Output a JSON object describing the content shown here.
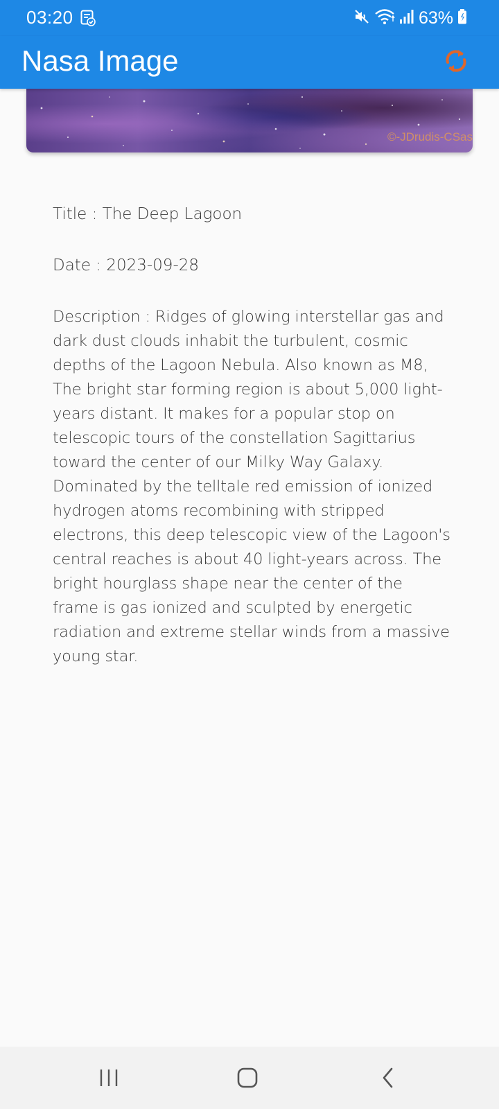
{
  "status_bar": {
    "time": "03:20",
    "battery": "63%",
    "icons": [
      "note-check-icon",
      "mute-icon",
      "wifi-icon",
      "signal-icon",
      "battery-icon"
    ]
  },
  "app_bar": {
    "title": "Nasa Image",
    "refresh_icon": "refresh-icon",
    "refresh_color": "#e0662a",
    "background": "#1e88e5"
  },
  "image": {
    "credit": "©-JDrudis-CSas"
  },
  "details": {
    "title": "Title :  The Deep Lagoon",
    "date": "Date : 2023-09-28",
    "description": "Description : Ridges of glowing interstellar gas and dark dust clouds inhabit the turbulent, cosmic depths of the Lagoon Nebula. Also known as M8, The bright star forming region is about 5,000 light-years distant. It makes for a popular stop on telescopic tours of the constellation Sagittarius toward the center of our Milky Way Galaxy. Dominated by the telltale red emission of ionized hydrogen atoms recombining with stripped electrons, this deep telescopic view of the Lagoon's central reaches is about 40 light-years across. The bright hourglass shape near the center of the frame is gas ionized and sculpted by energetic radiation and extreme stellar winds from a massive young star."
  },
  "nav_bar": {
    "buttons": [
      "recent-apps-icon",
      "home-icon",
      "back-icon"
    ]
  }
}
